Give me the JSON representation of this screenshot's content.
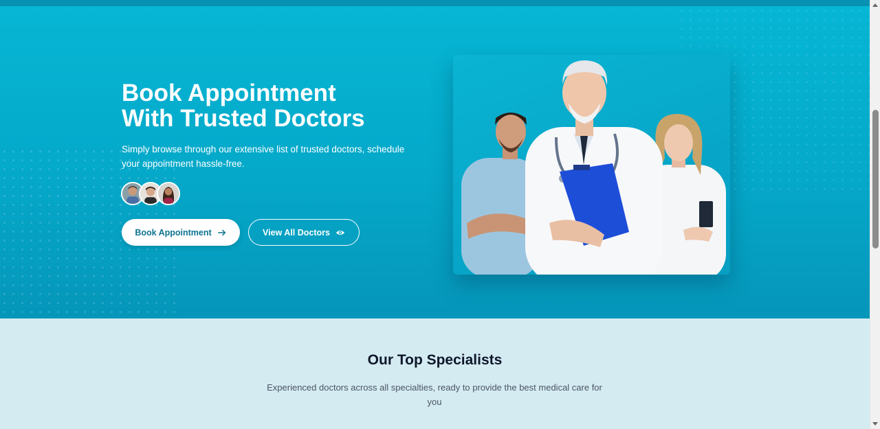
{
  "hero": {
    "title_line1": "Book Appointment",
    "title_line2": "With Trusted Doctors",
    "subtitle": "Simply browse through our extensive list of trusted doctors, schedule your appointment hassle-free.",
    "avatars": [
      "doctor-avatar-1",
      "doctor-avatar-2",
      "doctor-avatar-3"
    ],
    "primary_button": {
      "label": "Book Appointment",
      "icon": "arrow-right-icon"
    },
    "secondary_button": {
      "label": "View All Doctors",
      "icon": "eye-icon"
    },
    "image": "doctors-group-photo"
  },
  "specialists": {
    "title": "Our Top Specialists",
    "subtitle": "Experienced doctors across all specialties, ready to provide the best medical care for you"
  },
  "colors": {
    "hero_bg": "#06b6d4",
    "hero_bg_dark": "#0596ba",
    "section_bg": "#d4ebf2",
    "button_text": "#0e7490",
    "heading": "#0f172a"
  }
}
